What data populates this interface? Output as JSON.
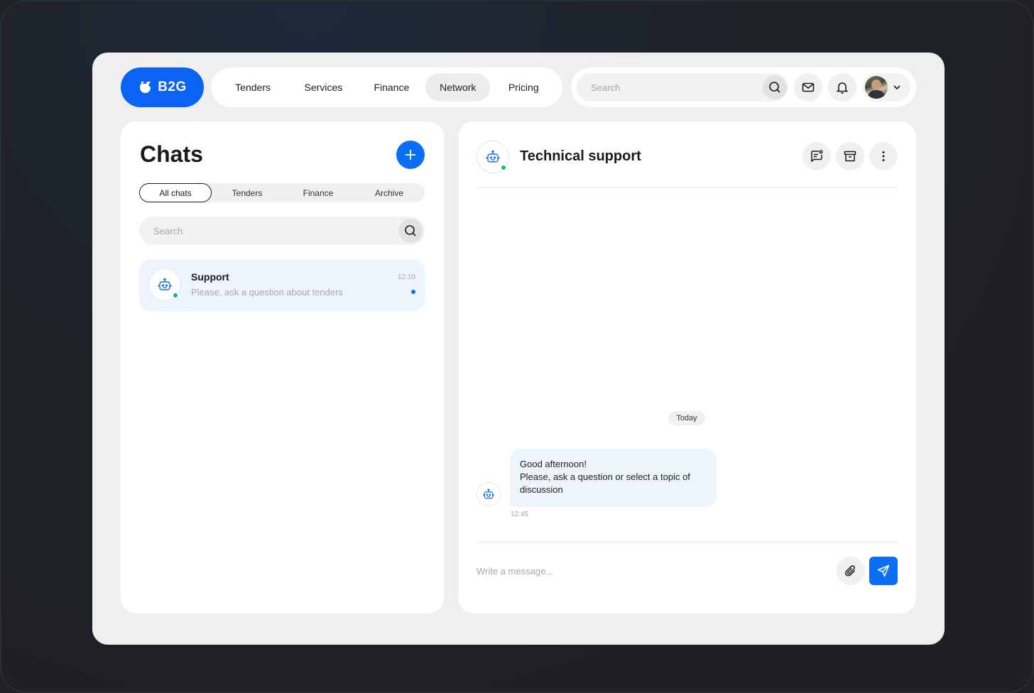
{
  "brand": {
    "name": "B2G",
    "color": "#0b63f6"
  },
  "nav": {
    "items": [
      {
        "label": "Tenders"
      },
      {
        "label": "Services"
      },
      {
        "label": "Finance"
      },
      {
        "label": "Network",
        "active": true
      },
      {
        "label": "Pricing"
      }
    ]
  },
  "topbar": {
    "search_placeholder": "Search",
    "icons": [
      "search-icon",
      "mail-icon",
      "bell-icon",
      "chevron-down-icon"
    ]
  },
  "chats": {
    "title": "Chats",
    "filters": [
      {
        "label": "All chats",
        "active": true
      },
      {
        "label": "Tenders"
      },
      {
        "label": "Finance"
      },
      {
        "label": "Archive"
      }
    ],
    "search_placeholder": "Search",
    "items": [
      {
        "name": "Support",
        "preview": "Please, ask a question about tenders",
        "time": "12:10",
        "unread": true,
        "online": true
      }
    ]
  },
  "conversation": {
    "title": "Technical support",
    "online": true,
    "date_label": "Today",
    "messages": [
      {
        "lines": [
          "Good afternoon!",
          "Please, ask a question or select a topic of discussion"
        ],
        "time": "12:45"
      }
    ],
    "composer_placeholder": "Write a message..."
  },
  "colors": {
    "accent": "#0b6ff6",
    "online": "#1bb96a",
    "bubble": "#edf4fe"
  }
}
